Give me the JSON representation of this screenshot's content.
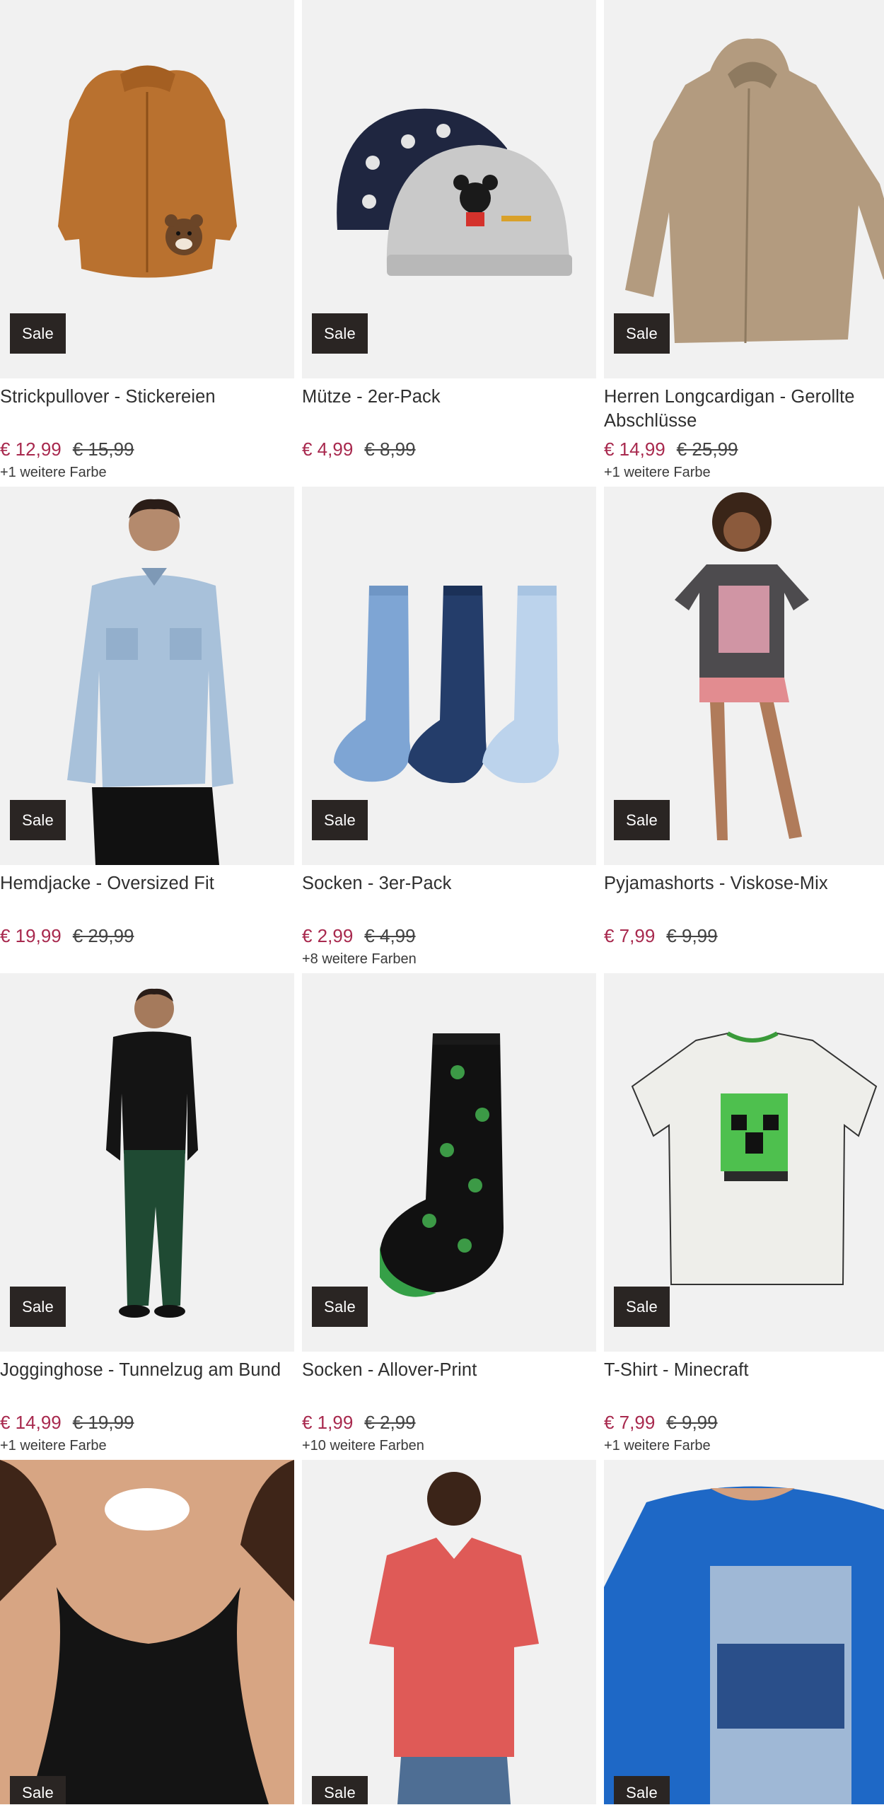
{
  "badge_label": "Sale",
  "colors": {
    "sale_price": "#a8294e",
    "badge_bg": "#2a2523",
    "image_bg": "#f1f1f1"
  },
  "products": [
    {
      "title": "Strickpullover - Stickereien",
      "price": "€ 12,99",
      "old_price": "€ 15,99",
      "more_colors": "+1 weitere Farbe",
      "image": "mustard-knit-cardigan-with-bear-icon"
    },
    {
      "title": "Mütze - 2er-Pack",
      "price": "€ 4,99",
      "old_price": "€ 8,99",
      "more_colors": "",
      "image": "mickey-beanies-icon"
    },
    {
      "title": "Herren Longcardigan - Gerollte Abschlüsse",
      "price": "€ 14,99",
      "old_price": "€ 25,99",
      "more_colors": "+1 weitere Farbe",
      "image": "beige-long-cardigan-icon"
    },
    {
      "title": "Hemdjacke - Oversized Fit",
      "price": "€ 19,99",
      "old_price": "€ 29,99",
      "more_colors": "",
      "image": "denim-shirt-jacket-icon"
    },
    {
      "title": "Socken - 3er-Pack",
      "price": "€ 2,99",
      "old_price": "€ 4,99",
      "more_colors": "+8 weitere Farben",
      "image": "blue-socks-3pack-icon"
    },
    {
      "title": "Pyjamashorts - Viskose-Mix",
      "price": "€ 7,99",
      "old_price": "€ 9,99",
      "more_colors": "",
      "image": "pyjama-good-mood-club-icon"
    },
    {
      "title": "Jogginghose - Tunnelzug am Bund",
      "price": "€ 14,99",
      "old_price": "€ 19,99",
      "more_colors": "+1 weitere Farbe",
      "image": "green-jogging-pants-icon"
    },
    {
      "title": "Socken - Allover-Print",
      "price": "€ 1,99",
      "old_price": "€ 2,99",
      "more_colors": "+10 weitere Farben",
      "image": "frog-print-sock-icon"
    },
    {
      "title": "T-Shirt - Minecraft",
      "price": "€ 7,99",
      "old_price": "€ 9,99",
      "more_colors": "+1 weitere Farbe",
      "image": "minecraft-tshirt-icon"
    }
  ],
  "partial_products": [
    {
      "image": "black-lace-bra-icon"
    },
    {
      "image": "red-vneck-tshirt-icon"
    },
    {
      "image": "blue-print-tshirt-icon"
    }
  ]
}
